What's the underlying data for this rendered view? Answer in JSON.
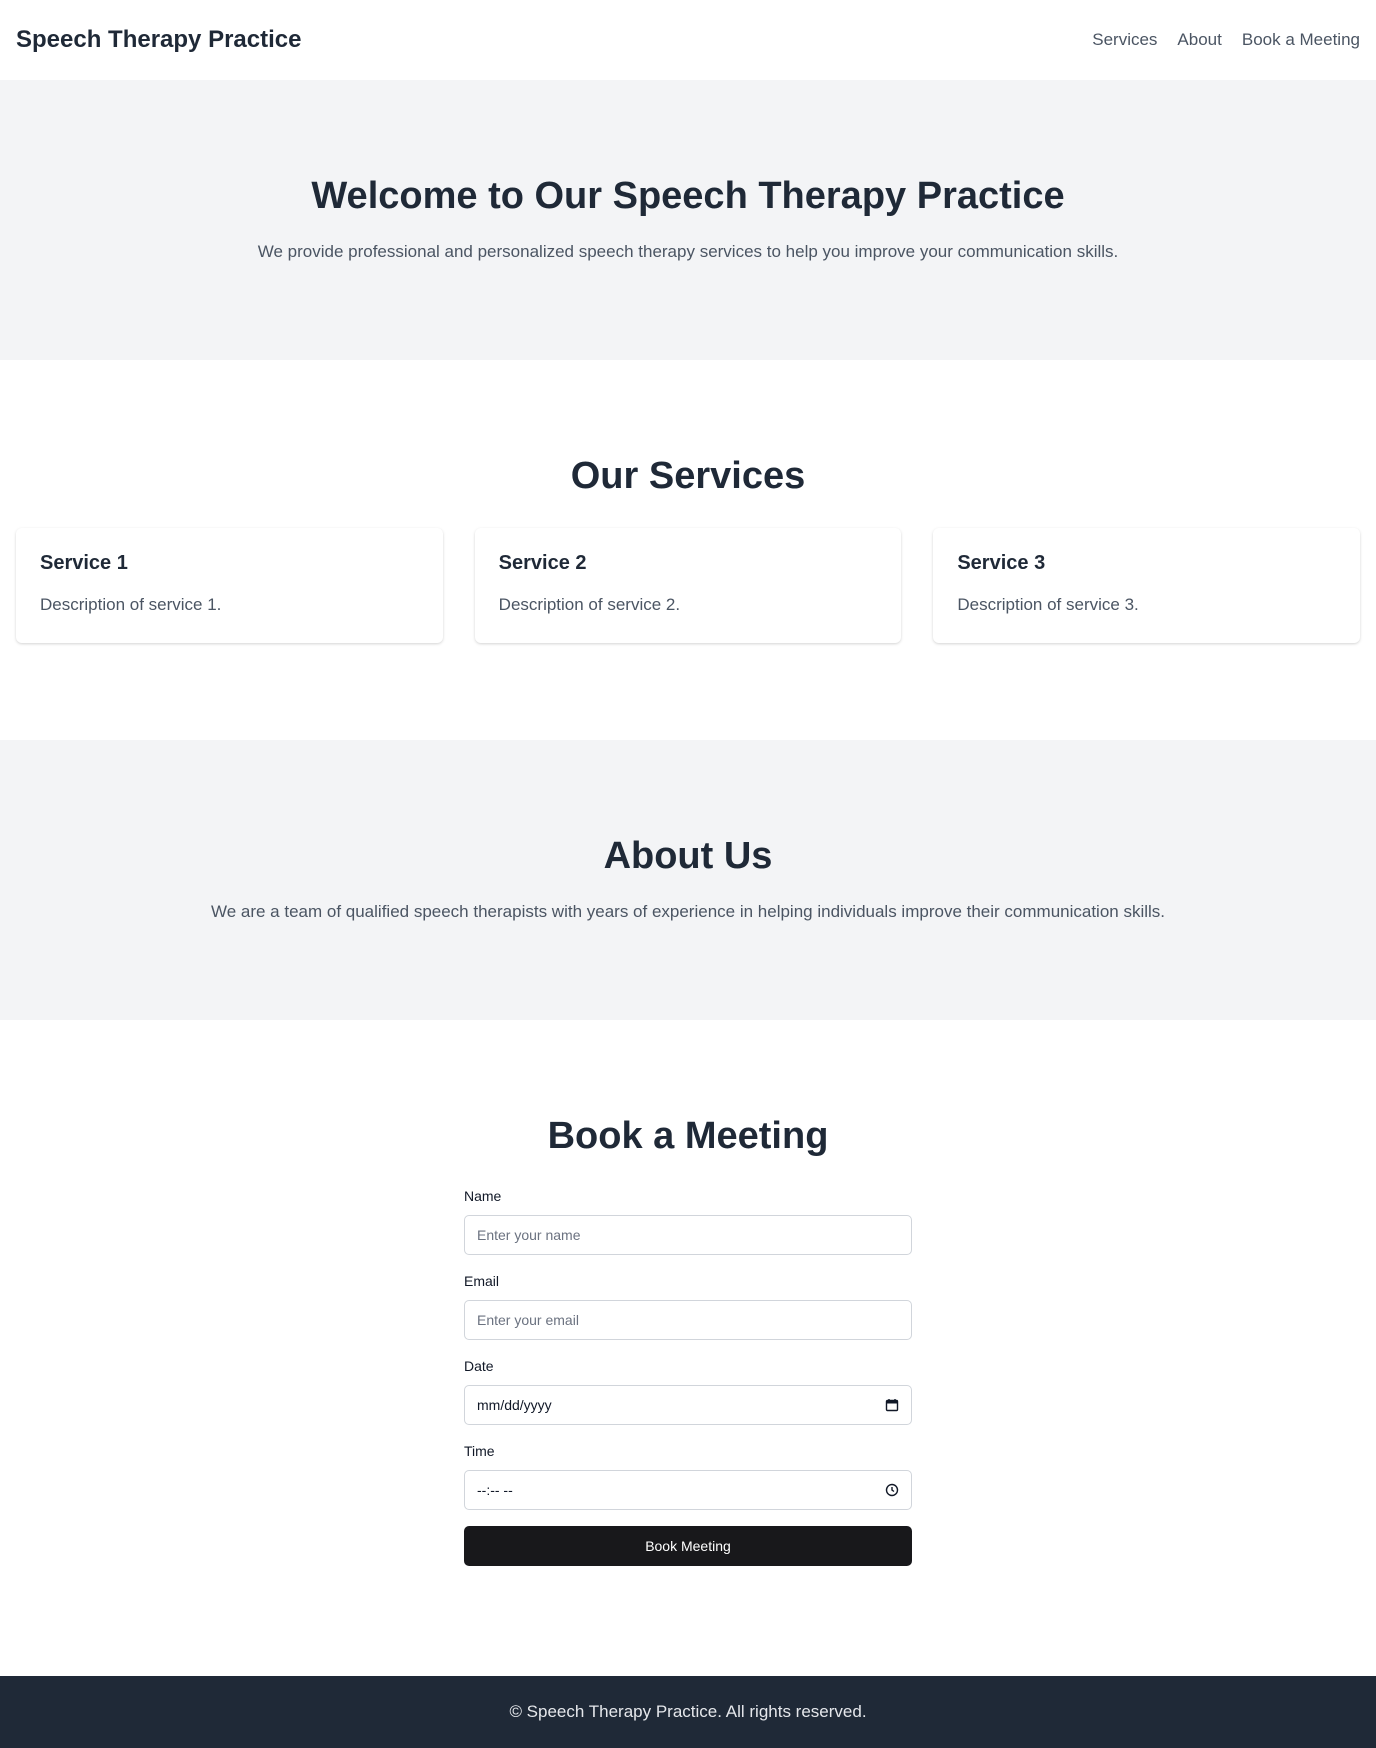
{
  "header": {
    "brand": "Speech Therapy Practice",
    "nav": [
      {
        "label": "Services"
      },
      {
        "label": "About"
      },
      {
        "label": "Book a Meeting"
      }
    ]
  },
  "hero": {
    "title": "Welcome to Our Speech Therapy Practice",
    "subtitle": "We provide professional and personalized speech therapy services to help you improve your communication skills."
  },
  "services": {
    "title": "Our Services",
    "items": [
      {
        "title": "Service 1",
        "description": "Description of service 1."
      },
      {
        "title": "Service 2",
        "description": "Description of service 2."
      },
      {
        "title": "Service 3",
        "description": "Description of service 3."
      }
    ]
  },
  "about": {
    "title": "About Us",
    "text": "We are a team of qualified speech therapists with years of experience in helping individuals improve their communication skills."
  },
  "booking": {
    "title": "Book a Meeting",
    "name": {
      "label": "Name",
      "placeholder": "Enter your name"
    },
    "email": {
      "label": "Email",
      "placeholder": "Enter your email"
    },
    "date": {
      "label": "Date",
      "value": "mm/dd/yyyy",
      "icon": "calendar-icon"
    },
    "time": {
      "label": "Time",
      "value": "--:-- --",
      "icon": "clock-icon"
    },
    "submit_label": "Book Meeting"
  },
  "footer": {
    "text": "© Speech Therapy Practice. All rights reserved."
  },
  "colors": {
    "text_dark": "#1f2937",
    "text_muted": "#4b5563",
    "section_gray": "#f3f4f6",
    "button_bg": "#18181b",
    "footer_bg": "#1f2937"
  }
}
